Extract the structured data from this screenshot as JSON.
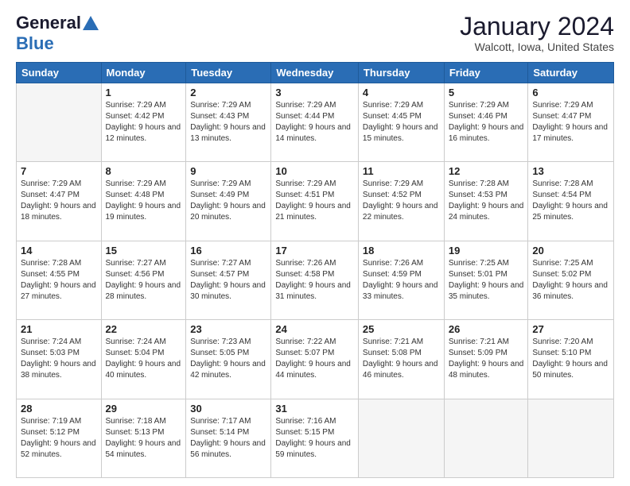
{
  "header": {
    "logo_line1": "General",
    "logo_line2": "Blue",
    "title": "January 2024",
    "subtitle": "Walcott, Iowa, United States"
  },
  "weekdays": [
    "Sunday",
    "Monday",
    "Tuesday",
    "Wednesday",
    "Thursday",
    "Friday",
    "Saturday"
  ],
  "weeks": [
    [
      {
        "day": "",
        "sunrise": "",
        "sunset": "",
        "daylight": ""
      },
      {
        "day": "1",
        "sunrise": "Sunrise: 7:29 AM",
        "sunset": "Sunset: 4:42 PM",
        "daylight": "Daylight: 9 hours and 12 minutes."
      },
      {
        "day": "2",
        "sunrise": "Sunrise: 7:29 AM",
        "sunset": "Sunset: 4:43 PM",
        "daylight": "Daylight: 9 hours and 13 minutes."
      },
      {
        "day": "3",
        "sunrise": "Sunrise: 7:29 AM",
        "sunset": "Sunset: 4:44 PM",
        "daylight": "Daylight: 9 hours and 14 minutes."
      },
      {
        "day": "4",
        "sunrise": "Sunrise: 7:29 AM",
        "sunset": "Sunset: 4:45 PM",
        "daylight": "Daylight: 9 hours and 15 minutes."
      },
      {
        "day": "5",
        "sunrise": "Sunrise: 7:29 AM",
        "sunset": "Sunset: 4:46 PM",
        "daylight": "Daylight: 9 hours and 16 minutes."
      },
      {
        "day": "6",
        "sunrise": "Sunrise: 7:29 AM",
        "sunset": "Sunset: 4:47 PM",
        "daylight": "Daylight: 9 hours and 17 minutes."
      }
    ],
    [
      {
        "day": "7",
        "sunrise": "Sunrise: 7:29 AM",
        "sunset": "Sunset: 4:47 PM",
        "daylight": "Daylight: 9 hours and 18 minutes."
      },
      {
        "day": "8",
        "sunrise": "Sunrise: 7:29 AM",
        "sunset": "Sunset: 4:48 PM",
        "daylight": "Daylight: 9 hours and 19 minutes."
      },
      {
        "day": "9",
        "sunrise": "Sunrise: 7:29 AM",
        "sunset": "Sunset: 4:49 PM",
        "daylight": "Daylight: 9 hours and 20 minutes."
      },
      {
        "day": "10",
        "sunrise": "Sunrise: 7:29 AM",
        "sunset": "Sunset: 4:51 PM",
        "daylight": "Daylight: 9 hours and 21 minutes."
      },
      {
        "day": "11",
        "sunrise": "Sunrise: 7:29 AM",
        "sunset": "Sunset: 4:52 PM",
        "daylight": "Daylight: 9 hours and 22 minutes."
      },
      {
        "day": "12",
        "sunrise": "Sunrise: 7:28 AM",
        "sunset": "Sunset: 4:53 PM",
        "daylight": "Daylight: 9 hours and 24 minutes."
      },
      {
        "day": "13",
        "sunrise": "Sunrise: 7:28 AM",
        "sunset": "Sunset: 4:54 PM",
        "daylight": "Daylight: 9 hours and 25 minutes."
      }
    ],
    [
      {
        "day": "14",
        "sunrise": "Sunrise: 7:28 AM",
        "sunset": "Sunset: 4:55 PM",
        "daylight": "Daylight: 9 hours and 27 minutes."
      },
      {
        "day": "15",
        "sunrise": "Sunrise: 7:27 AM",
        "sunset": "Sunset: 4:56 PM",
        "daylight": "Daylight: 9 hours and 28 minutes."
      },
      {
        "day": "16",
        "sunrise": "Sunrise: 7:27 AM",
        "sunset": "Sunset: 4:57 PM",
        "daylight": "Daylight: 9 hours and 30 minutes."
      },
      {
        "day": "17",
        "sunrise": "Sunrise: 7:26 AM",
        "sunset": "Sunset: 4:58 PM",
        "daylight": "Daylight: 9 hours and 31 minutes."
      },
      {
        "day": "18",
        "sunrise": "Sunrise: 7:26 AM",
        "sunset": "Sunset: 4:59 PM",
        "daylight": "Daylight: 9 hours and 33 minutes."
      },
      {
        "day": "19",
        "sunrise": "Sunrise: 7:25 AM",
        "sunset": "Sunset: 5:01 PM",
        "daylight": "Daylight: 9 hours and 35 minutes."
      },
      {
        "day": "20",
        "sunrise": "Sunrise: 7:25 AM",
        "sunset": "Sunset: 5:02 PM",
        "daylight": "Daylight: 9 hours and 36 minutes."
      }
    ],
    [
      {
        "day": "21",
        "sunrise": "Sunrise: 7:24 AM",
        "sunset": "Sunset: 5:03 PM",
        "daylight": "Daylight: 9 hours and 38 minutes."
      },
      {
        "day": "22",
        "sunrise": "Sunrise: 7:24 AM",
        "sunset": "Sunset: 5:04 PM",
        "daylight": "Daylight: 9 hours and 40 minutes."
      },
      {
        "day": "23",
        "sunrise": "Sunrise: 7:23 AM",
        "sunset": "Sunset: 5:05 PM",
        "daylight": "Daylight: 9 hours and 42 minutes."
      },
      {
        "day": "24",
        "sunrise": "Sunrise: 7:22 AM",
        "sunset": "Sunset: 5:07 PM",
        "daylight": "Daylight: 9 hours and 44 minutes."
      },
      {
        "day": "25",
        "sunrise": "Sunrise: 7:21 AM",
        "sunset": "Sunset: 5:08 PM",
        "daylight": "Daylight: 9 hours and 46 minutes."
      },
      {
        "day": "26",
        "sunrise": "Sunrise: 7:21 AM",
        "sunset": "Sunset: 5:09 PM",
        "daylight": "Daylight: 9 hours and 48 minutes."
      },
      {
        "day": "27",
        "sunrise": "Sunrise: 7:20 AM",
        "sunset": "Sunset: 5:10 PM",
        "daylight": "Daylight: 9 hours and 50 minutes."
      }
    ],
    [
      {
        "day": "28",
        "sunrise": "Sunrise: 7:19 AM",
        "sunset": "Sunset: 5:12 PM",
        "daylight": "Daylight: 9 hours and 52 minutes."
      },
      {
        "day": "29",
        "sunrise": "Sunrise: 7:18 AM",
        "sunset": "Sunset: 5:13 PM",
        "daylight": "Daylight: 9 hours and 54 minutes."
      },
      {
        "day": "30",
        "sunrise": "Sunrise: 7:17 AM",
        "sunset": "Sunset: 5:14 PM",
        "daylight": "Daylight: 9 hours and 56 minutes."
      },
      {
        "day": "31",
        "sunrise": "Sunrise: 7:16 AM",
        "sunset": "Sunset: 5:15 PM",
        "daylight": "Daylight: 9 hours and 59 minutes."
      },
      {
        "day": "",
        "sunrise": "",
        "sunset": "",
        "daylight": ""
      },
      {
        "day": "",
        "sunrise": "",
        "sunset": "",
        "daylight": ""
      },
      {
        "day": "",
        "sunrise": "",
        "sunset": "",
        "daylight": ""
      }
    ]
  ]
}
